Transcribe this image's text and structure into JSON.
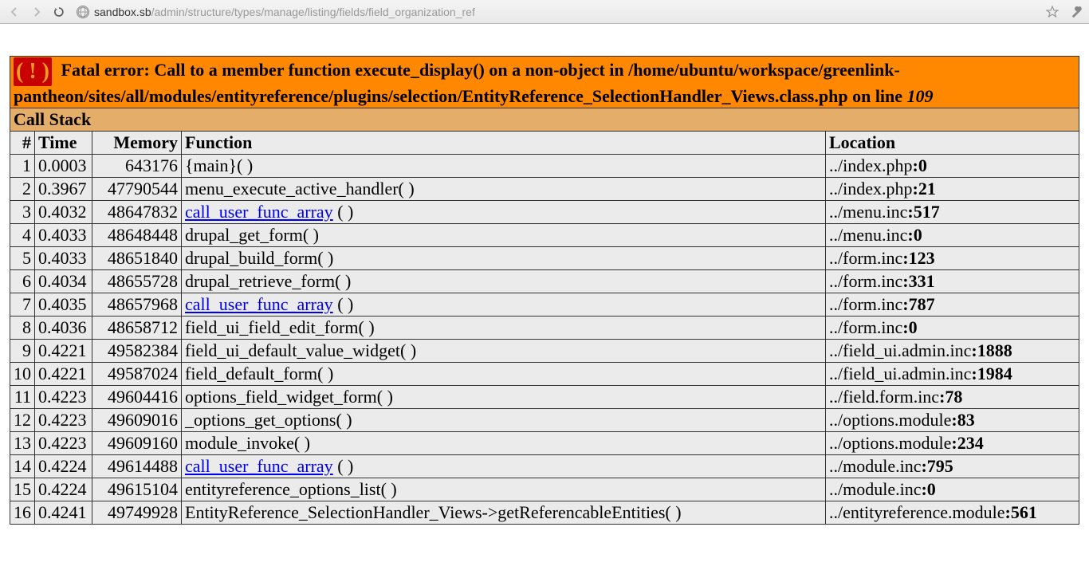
{
  "browser": {
    "url_host": "sandbox.sb",
    "url_path": "/admin/structure/types/manage/listing/fields/field_organization_ref"
  },
  "error": {
    "prefix": "Fatal error",
    "message_part1": ": Call to a member function execute_display() on a non-object in /home/ubuntu/workspace/greenlink-pantheon/sites/all/modules/entityreference/plugins/selection/EntityReference_SelectionHandler_Views.class.php on line ",
    "line": "109"
  },
  "callstack_label": "Call Stack",
  "headers": {
    "num": "#",
    "time": "Time",
    "memory": "Memory",
    "function": "Function",
    "location": "Location"
  },
  "rows": [
    {
      "n": "1",
      "time": "0.0003",
      "mem": "643176",
      "func": "{main}( )",
      "link": false,
      "loc_file": "../index.php",
      "loc_line": ":0"
    },
    {
      "n": "2",
      "time": "0.3967",
      "mem": "47790544",
      "func": "menu_execute_active_handler( )",
      "link": false,
      "loc_file": "../index.php",
      "loc_line": ":21"
    },
    {
      "n": "3",
      "time": "0.4032",
      "mem": "48647832",
      "func": "call_user_func_array",
      "func_suffix": " ( )",
      "link": true,
      "loc_file": "../menu.inc",
      "loc_line": ":517"
    },
    {
      "n": "4",
      "time": "0.4033",
      "mem": "48648448",
      "func": "drupal_get_form( )",
      "link": false,
      "loc_file": "../menu.inc",
      "loc_line": ":0"
    },
    {
      "n": "5",
      "time": "0.4033",
      "mem": "48651840",
      "func": "drupal_build_form( )",
      "link": false,
      "loc_file": "../form.inc",
      "loc_line": ":123"
    },
    {
      "n": "6",
      "time": "0.4034",
      "mem": "48655728",
      "func": "drupal_retrieve_form( )",
      "link": false,
      "loc_file": "../form.inc",
      "loc_line": ":331"
    },
    {
      "n": "7",
      "time": "0.4035",
      "mem": "48657968",
      "func": "call_user_func_array",
      "func_suffix": " ( )",
      "link": true,
      "loc_file": "../form.inc",
      "loc_line": ":787"
    },
    {
      "n": "8",
      "time": "0.4036",
      "mem": "48658712",
      "func": "field_ui_field_edit_form( )",
      "link": false,
      "loc_file": "../form.inc",
      "loc_line": ":0"
    },
    {
      "n": "9",
      "time": "0.4221",
      "mem": "49582384",
      "func": "field_ui_default_value_widget( )",
      "link": false,
      "loc_file": "../field_ui.admin.inc",
      "loc_line": ":1888"
    },
    {
      "n": "10",
      "time": "0.4221",
      "mem": "49587024",
      "func": "field_default_form( )",
      "link": false,
      "loc_file": "../field_ui.admin.inc",
      "loc_line": ":1984"
    },
    {
      "n": "11",
      "time": "0.4223",
      "mem": "49604416",
      "func": "options_field_widget_form( )",
      "link": false,
      "loc_file": "../field.form.inc",
      "loc_line": ":78"
    },
    {
      "n": "12",
      "time": "0.4223",
      "mem": "49609016",
      "func": "_options_get_options( )",
      "link": false,
      "loc_file": "../options.module",
      "loc_line": ":83"
    },
    {
      "n": "13",
      "time": "0.4223",
      "mem": "49609160",
      "func": "module_invoke( )",
      "link": false,
      "loc_file": "../options.module",
      "loc_line": ":234"
    },
    {
      "n": "14",
      "time": "0.4224",
      "mem": "49614488",
      "func": "call_user_func_array",
      "func_suffix": " ( )",
      "link": true,
      "loc_file": "../module.inc",
      "loc_line": ":795"
    },
    {
      "n": "15",
      "time": "0.4224",
      "mem": "49615104",
      "func": "entityreference_options_list( )",
      "link": false,
      "loc_file": "../module.inc",
      "loc_line": ":0"
    },
    {
      "n": "16",
      "time": "0.4241",
      "mem": "49749928",
      "func": "EntityReference_SelectionHandler_Views->getReferencableEntities( )",
      "link": false,
      "loc_file": "../entityreference.module",
      "loc_line": ":561"
    }
  ]
}
